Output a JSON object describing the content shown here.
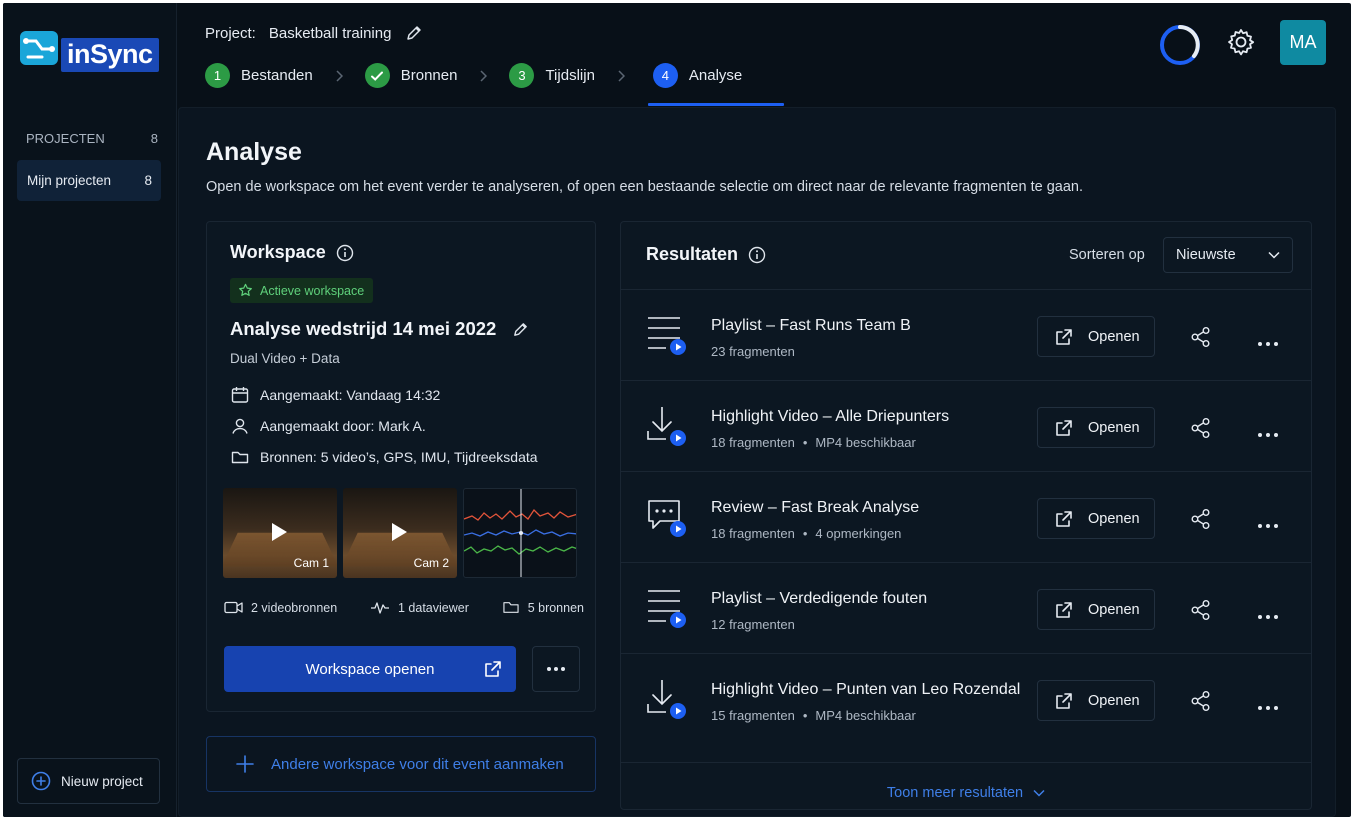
{
  "app": {
    "logo_text": "inSync"
  },
  "sidebar": {
    "section_label": "PROJECTEN",
    "section_count": "8",
    "items": [
      {
        "label": "Mijn projecten",
        "count": "8"
      }
    ],
    "new_project_label": "Nieuw project"
  },
  "header": {
    "project_label": "Project:",
    "project_name": "Basketball training",
    "steps": [
      {
        "num": "1",
        "label": "Bestanden",
        "state": "done"
      },
      {
        "num": "",
        "label": "Bronnen",
        "state": "done-check"
      },
      {
        "num": "3",
        "label": "Tijdslijn",
        "state": "done"
      },
      {
        "num": "4",
        "label": "Analyse",
        "state": "active"
      }
    ],
    "avatar_initials": "MA",
    "colors": {
      "accent": "#1d5ff2",
      "done": "#2c9b45",
      "avatar": "#0f8aa1"
    }
  },
  "page": {
    "title": "Analyse",
    "description": "Open de workspace om het event verder te analyseren, of open een bestaande selectie om direct naar de relevante fragmenten te gaan."
  },
  "workspace": {
    "title": "Workspace",
    "badge": "Actieve workspace",
    "name": "Analyse wedstrijd 14 mei 2022",
    "type": "Dual Video + Data",
    "created": "Aangemaakt: Vandaag 14:32",
    "created_by": "Aangemaakt door: Mark A.",
    "sources": "Bronnen: 5 video’s, GPS, IMU, Tijdreeksdata",
    "thumbs": [
      {
        "label": "Cam 1"
      },
      {
        "label": "Cam 2"
      }
    ],
    "stats": {
      "video_sources": "2 videobronnen",
      "data_viewers": "1 dataviewer",
      "sources": "5 bronnen"
    },
    "open_label": "Workspace openen",
    "other_label": "Andere workspace voor dit event aanmaken"
  },
  "results": {
    "title": "Resultaten",
    "sort_label": "Sorteren op",
    "sort_value": "Nieuwste",
    "open_label": "Openen",
    "items": [
      {
        "icon": "playlist-icon",
        "title": "Playlist – Fast Runs Team B",
        "sub1": "23 fragmenten",
        "sub2": ""
      },
      {
        "icon": "download-video-icon",
        "title": "Highlight Video – Alle Driepunters",
        "sub1": "18 fragmenten",
        "sub2": "MP4 beschikbaar"
      },
      {
        "icon": "review-comment-icon",
        "title": "Review – Fast Break Analyse",
        "sub1": "18 fragmenten",
        "sub2": "4 opmerkingen"
      },
      {
        "icon": "playlist-icon",
        "title": "Playlist – Verdedigende fouten",
        "sub1": "12 fragmenten",
        "sub2": ""
      },
      {
        "icon": "download-video-icon",
        "title": "Highlight Video – Punten van Leo Rozendal",
        "sub1": "15 fragmenten",
        "sub2": "MP4 beschikbaar"
      }
    ],
    "show_more_label": "Toon meer resultaten"
  }
}
